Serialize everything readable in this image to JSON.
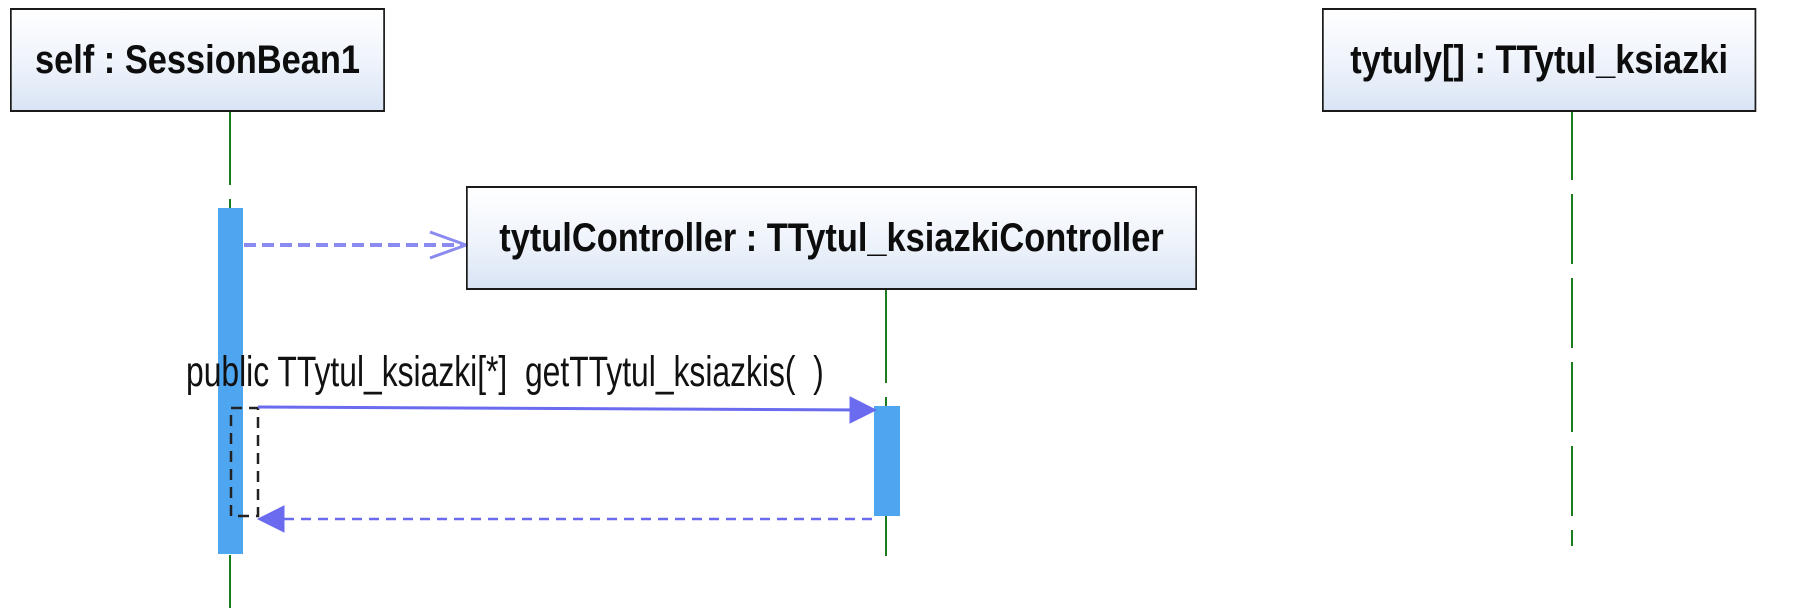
{
  "diagram": {
    "type": "sequence",
    "lifelines": {
      "self": {
        "label": "self : SessionBean1"
      },
      "controller": {
        "label": "tytulController : TTytul_ksiazkiController"
      },
      "tytuly": {
        "label": "tytuly[] : TTytul_ksiazki"
      }
    },
    "messages": {
      "create": {
        "label": "",
        "style": "dashed-open-arrow"
      },
      "call": {
        "label": "public TTytul_ksiazki[*]  getTTytul_ksiazkis(  )",
        "style": "solid-filled-arrow"
      },
      "return": {
        "label": "",
        "style": "dashed-filled-arrow"
      }
    },
    "colors": {
      "lifeline": "#1e7a1e",
      "activation": "#4ea6f0",
      "message": "#6b6bf0",
      "box_border": "#1a1a1a"
    }
  }
}
